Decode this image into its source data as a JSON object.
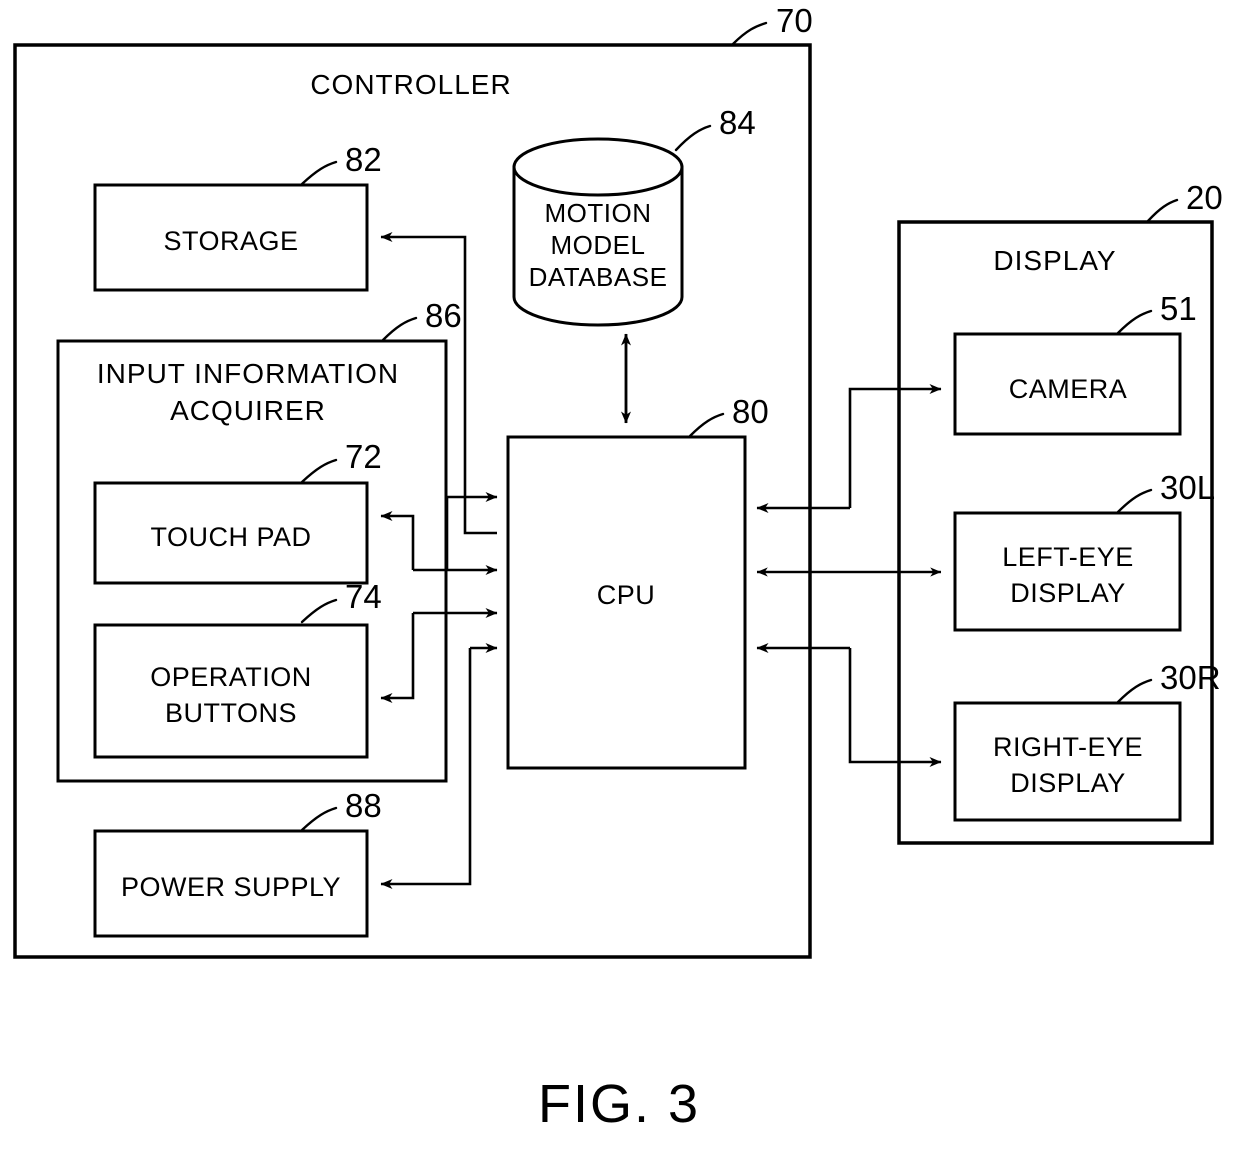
{
  "figure": {
    "caption": "FIG. 3",
    "type": "block-diagram"
  },
  "containers": [
    {
      "id": "controller",
      "title": "CONTROLLER",
      "ref": "70"
    },
    {
      "id": "display",
      "title": "DISPLAY",
      "ref": "20"
    },
    {
      "id": "input_acquirer",
      "title_line1": "INPUT INFORMATION",
      "title_line2": "ACQUIRER",
      "ref": "86"
    }
  ],
  "blocks": {
    "storage": {
      "label": "STORAGE",
      "ref": "82"
    },
    "motion_model_database": {
      "line1": "MOTION",
      "line2": "MODEL",
      "line3": "DATABASE",
      "ref": "84"
    },
    "cpu": {
      "label": "CPU",
      "ref": "80"
    },
    "touch_pad": {
      "label": "TOUCH PAD",
      "ref": "72"
    },
    "operation_buttons": {
      "line1": "OPERATION",
      "line2": "BUTTONS",
      "ref": "74"
    },
    "power_supply": {
      "label": "POWER SUPPLY",
      "ref": "88"
    },
    "camera": {
      "label": "CAMERA",
      "ref": "51"
    },
    "left_eye_display": {
      "line1": "LEFT-EYE",
      "line2": "DISPLAY",
      "ref": "30L"
    },
    "right_eye_display": {
      "line1": "RIGHT-EYE",
      "line2": "DISPLAY",
      "ref": "30R"
    }
  },
  "colors": {
    "stroke": "#000000",
    "background": "#ffffff"
  },
  "connections": [
    {
      "from": "cpu",
      "to": "motion_model_database",
      "style": "bidirectional"
    },
    {
      "from": "cpu",
      "to": "storage",
      "style": "unidirectional"
    },
    {
      "from": "touch_pad",
      "to": "cpu",
      "style": "bidirectional-pair"
    },
    {
      "from": "operation_buttons",
      "to": "cpu",
      "style": "bidirectional-pair"
    },
    {
      "from": "cpu",
      "to": "power_supply",
      "style": "unidirectional"
    },
    {
      "from": "cpu",
      "to": "camera",
      "style": "bidirectional-pair"
    },
    {
      "from": "cpu",
      "to": "left_eye_display",
      "style": "bidirectional"
    },
    {
      "from": "cpu",
      "to": "right_eye_display",
      "style": "bidirectional-pair"
    }
  ]
}
